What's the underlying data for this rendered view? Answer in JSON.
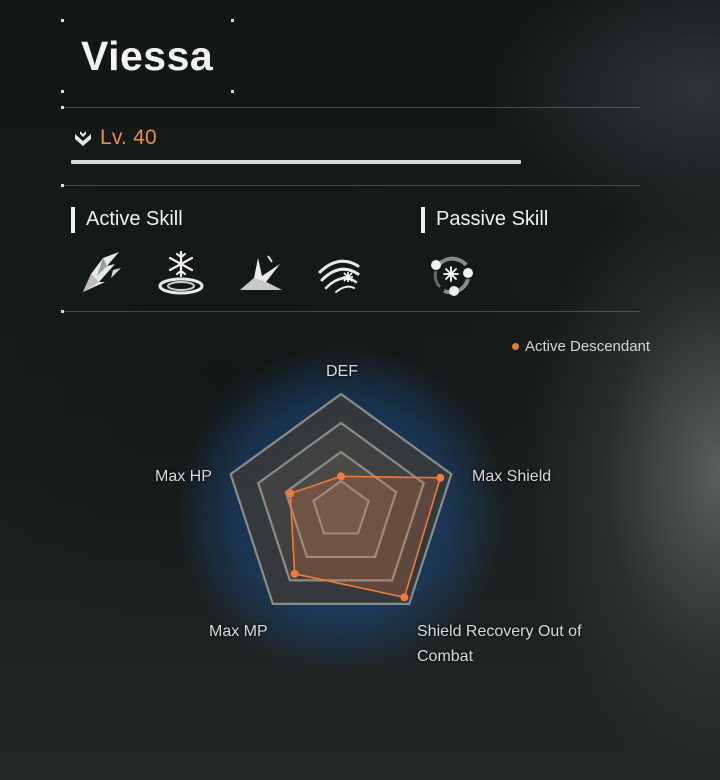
{
  "descendant": {
    "name": "Viessa",
    "level_label": "Lv. 40"
  },
  "skills": {
    "active_title": "Active Skill",
    "passive_title": "Passive Skill",
    "active_icons": [
      "ice-shard-skill-icon",
      "frost-circle-skill-icon",
      "ice-burst-skill-icon",
      "frost-vortex-skill-icon"
    ],
    "passive_icons": [
      "snowflake-orbit-skill-icon"
    ]
  },
  "legend": {
    "label": "Active Descendant",
    "color": "#f07a3a"
  },
  "chart_data": {
    "type": "radar",
    "axes": [
      "DEF",
      "Max Shield",
      "Shield Recovery Out of Combat",
      "Max MP",
      "Max HP"
    ],
    "series": [
      {
        "name": "Active Descendant",
        "values": [
          0.29,
          0.9,
          0.93,
          0.68,
          0.46
        ]
      }
    ],
    "range": [
      0,
      1
    ],
    "rings": 4,
    "colors": {
      "series": "#f07a3a",
      "glow": "#1f5fb3"
    }
  }
}
